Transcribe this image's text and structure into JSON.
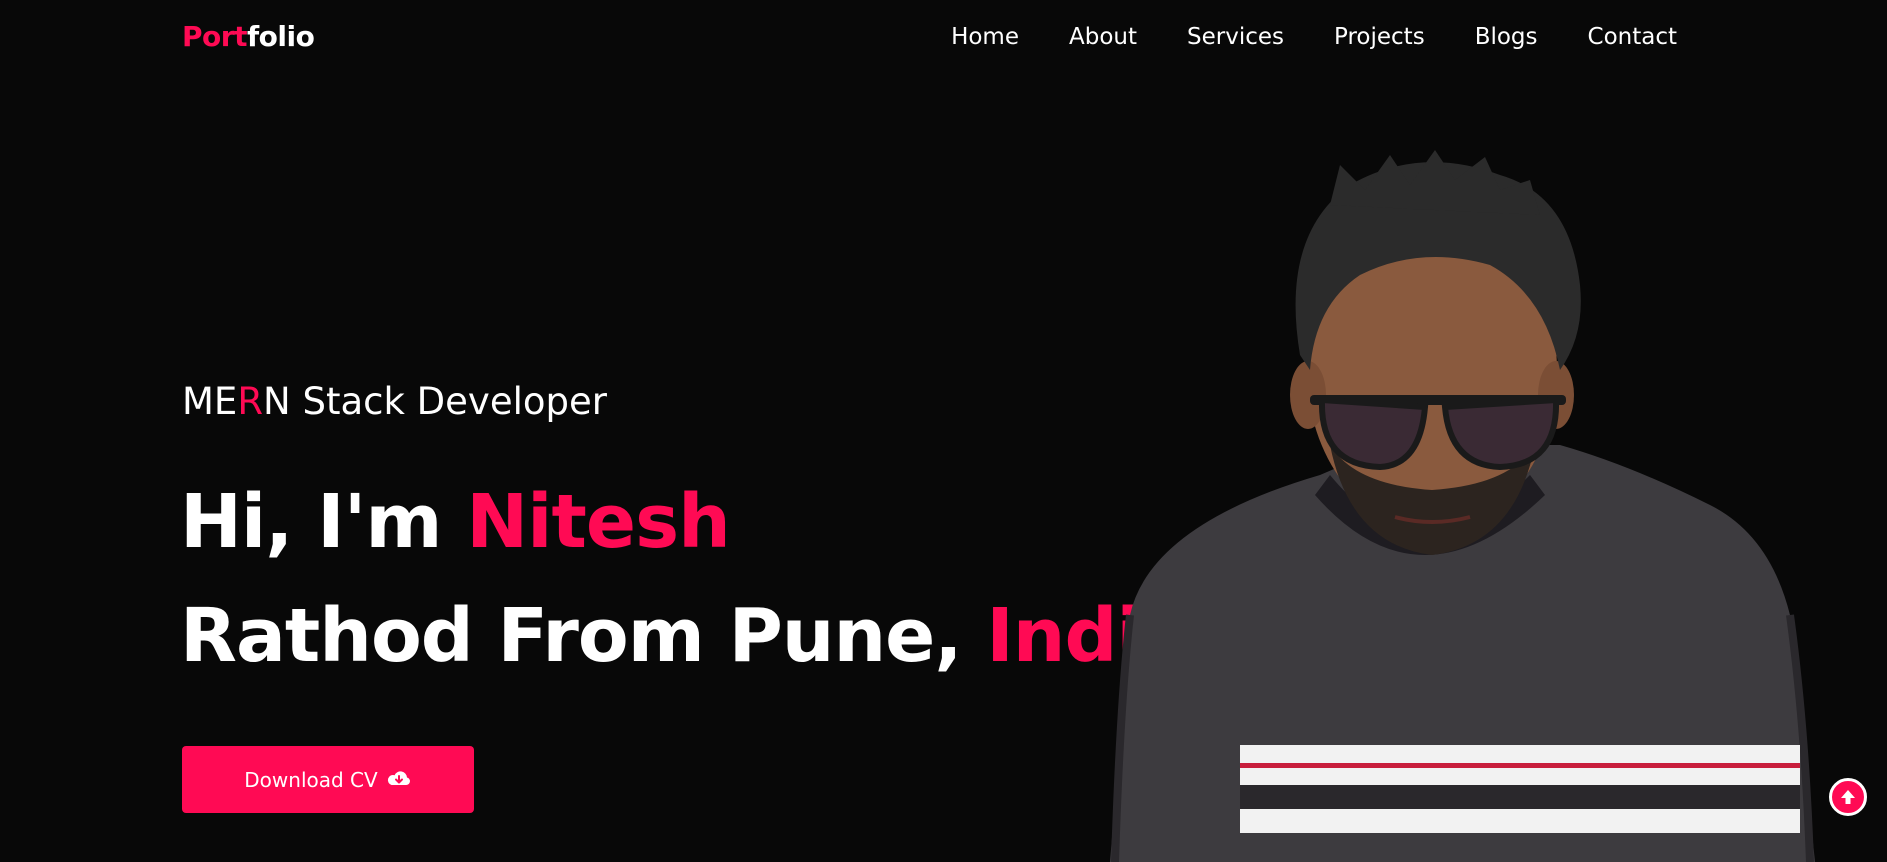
{
  "header": {
    "logo_part1": "Port",
    "logo_part2": "folio",
    "nav": [
      "Home",
      "About",
      "Services",
      "Projects",
      "Blogs",
      "Contact"
    ]
  },
  "hero": {
    "role_prefix": "ME",
    "role_accent": "R",
    "role_suffix": "N Stack Developer",
    "line1_plain": "Hi, I'm ",
    "line1_accent": "Nitesh",
    "line2_plain": "Rathod From Pune, ",
    "line2_accent": "India",
    "download_label": "Download CV",
    "download_icon": "cloud-download-icon"
  },
  "scroll_top_icon": "arrow-up-icon",
  "colors": {
    "accent": "#ff0a54",
    "background": "#080808",
    "text": "#ffffff"
  }
}
